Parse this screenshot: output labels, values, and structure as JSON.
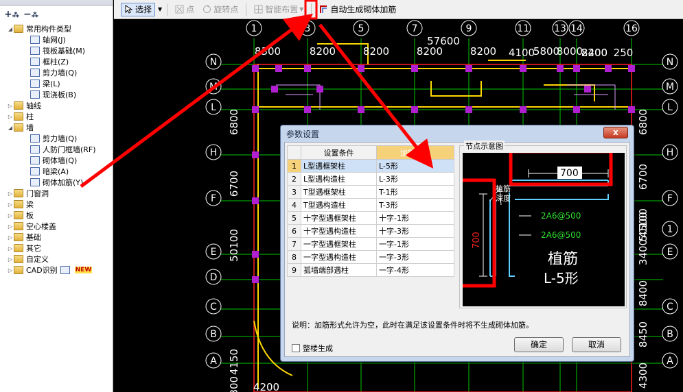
{
  "tree": {
    "expand_all_icon": "expand-all-icon",
    "collapse_all_icon": "collapse-all-icon",
    "items": [
      {
        "label": "常用构件类型",
        "level": 1,
        "folder": true,
        "expanded": true
      },
      {
        "label": "轴网(J)",
        "level": 2,
        "folder": false
      },
      {
        "label": "筏板基础(M)",
        "level": 2,
        "folder": false
      },
      {
        "label": "框柱(Z)",
        "level": 2,
        "folder": false
      },
      {
        "label": "剪力墙(Q)",
        "level": 2,
        "folder": false
      },
      {
        "label": "梁(L)",
        "level": 2,
        "folder": false
      },
      {
        "label": "现浇板(B)",
        "level": 2,
        "folder": false
      },
      {
        "label": "轴线",
        "level": 1,
        "folder": true,
        "expanded": false
      },
      {
        "label": "柱",
        "level": 1,
        "folder": true,
        "expanded": false
      },
      {
        "label": "墙",
        "level": 1,
        "folder": true,
        "expanded": true
      },
      {
        "label": "剪力墙(Q)",
        "level": 2,
        "folder": false
      },
      {
        "label": "人防门框墙(RF)",
        "level": 2,
        "folder": false
      },
      {
        "label": "砌体墙(Q)",
        "level": 2,
        "folder": false
      },
      {
        "label": "暗梁(A)",
        "level": 2,
        "folder": false
      },
      {
        "label": "砌体加筋(Y)",
        "level": 2,
        "folder": false
      },
      {
        "label": "门窗洞",
        "level": 1,
        "folder": true,
        "expanded": false
      },
      {
        "label": "梁",
        "level": 1,
        "folder": true,
        "expanded": false
      },
      {
        "label": "板",
        "level": 1,
        "folder": true,
        "expanded": false
      },
      {
        "label": "空心楼盖",
        "level": 1,
        "folder": true,
        "expanded": false
      },
      {
        "label": "基础",
        "level": 1,
        "folder": true,
        "expanded": false
      },
      {
        "label": "其它",
        "level": 1,
        "folder": true,
        "expanded": false
      },
      {
        "label": "自定义",
        "level": 1,
        "folder": true,
        "expanded": false
      },
      {
        "label": "CAD识别",
        "level": 1,
        "folder": true,
        "expanded": false,
        "badge": "NEW"
      }
    ]
  },
  "toolbar": {
    "select_label": "选择",
    "point_label": "点",
    "rotate_point_label": "旋转点",
    "smart_layout_label": "智能布置",
    "auto_generate_label": "自动生成砌体加筋"
  },
  "cad": {
    "top_axes": [
      "1",
      "3",
      "5",
      "7",
      "9",
      "11",
      "13",
      "14",
      "16"
    ],
    "left_axes": [
      "N",
      "M",
      "L",
      "H",
      "F",
      "E",
      "D",
      "C",
      "B",
      "A"
    ],
    "right_axes": [
      "N",
      "M",
      "L",
      "H",
      "F",
      "1",
      "E",
      "C",
      "B",
      "A"
    ],
    "top_dims": [
      "8300",
      "8200",
      "8200",
      "8200",
      "8200",
      "4100",
      "5800",
      "8000",
      "8200",
      "2400",
      "250"
    ],
    "total_dim": "57600",
    "left_dims": [
      "6800",
      "6700",
      "50100",
      "4150",
      "4300"
    ],
    "right_dims": [
      "6800",
      "6700",
      "50100",
      "3400",
      "4500",
      "8400",
      "8450",
      "4300"
    ],
    "bottom_dim": "4200"
  },
  "dialog": {
    "title": "参数设置",
    "close_label": "x",
    "table": {
      "headers": [
        "设置条件",
        "加筋形式"
      ],
      "rows": [
        {
          "num": "1",
          "condition": "L型遇框架柱",
          "form": "L-5形"
        },
        {
          "num": "2",
          "condition": "L型遇构造柱",
          "form": "L-3形"
        },
        {
          "num": "3",
          "condition": "T型遇框架柱",
          "form": "T-1形"
        },
        {
          "num": "4",
          "condition": "T型遇构造柱",
          "form": "T-3形"
        },
        {
          "num": "5",
          "condition": "十字型遇框架柱",
          "form": "十字-1形"
        },
        {
          "num": "6",
          "condition": "十字型遇构造柱",
          "form": "十字-3形"
        },
        {
          "num": "7",
          "condition": "一字型遇框架柱",
          "form": "一字-1形"
        },
        {
          "num": "8",
          "condition": "一字型遇构造柱",
          "form": "一字-3形"
        },
        {
          "num": "9",
          "condition": "孤墙端部遇柱",
          "form": "一字-4形"
        }
      ]
    },
    "node_group_label": "节点示意图",
    "node": {
      "length_top": "700",
      "length_left": "700",
      "anchor_label_1": "植筋",
      "anchor_label_2": "深度",
      "bar_label_1": "2A6@500",
      "bar_label_2": "2A6@500",
      "title_1": "植筋",
      "title_2": "L-5形"
    },
    "note": "说明：加筋形式允许为空，此时在满足该设置条件时将不生成砌体加筋。",
    "whole_building_label": "整楼生成",
    "ok_label": "确定",
    "cancel_label": "取消"
  },
  "colors": {
    "highlight_red": "#ff0000",
    "axis_green": "#00c800",
    "wall_yellow": "#ffd800",
    "column_purple": "#b020d0",
    "header_orange": "#f5d27a",
    "rebar_cyan": "#5fd0ff"
  }
}
